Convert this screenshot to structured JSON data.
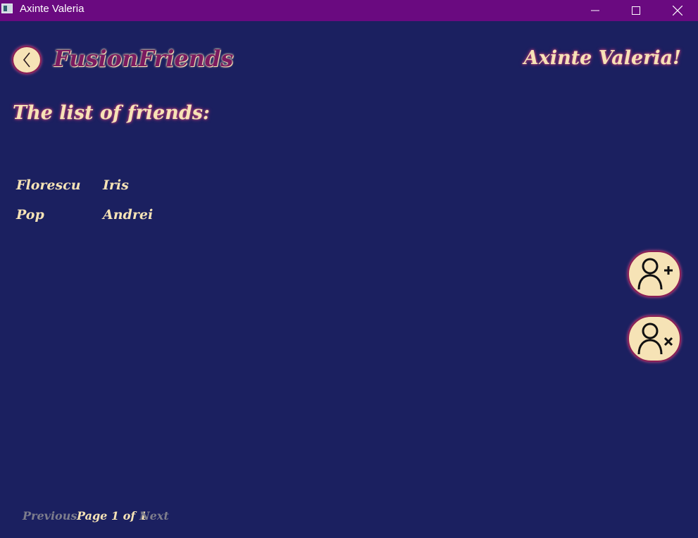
{
  "window": {
    "title": "Axinte Valeria"
  },
  "header": {
    "brand": "FusionFriends",
    "greeting": "Axinte Valeria!"
  },
  "main": {
    "list_title": "The list of friends:",
    "friends": [
      {
        "last_name": "Florescu",
        "first_name": "Iris"
      },
      {
        "last_name": "Pop",
        "first_name": "Andrei"
      }
    ]
  },
  "actions": {
    "add_icon": "add-user-icon",
    "remove_icon": "remove-user-icon"
  },
  "pagination": {
    "previous": "Previous",
    "page_info": "Page 1 of 1",
    "next": "Next"
  },
  "colors": {
    "background": "#1b2060",
    "titlebar": "#6a0a80",
    "accent_cream": "#f6e3b6",
    "accent_magenta": "#8a1f55",
    "disabled": "#7d7d8c"
  }
}
